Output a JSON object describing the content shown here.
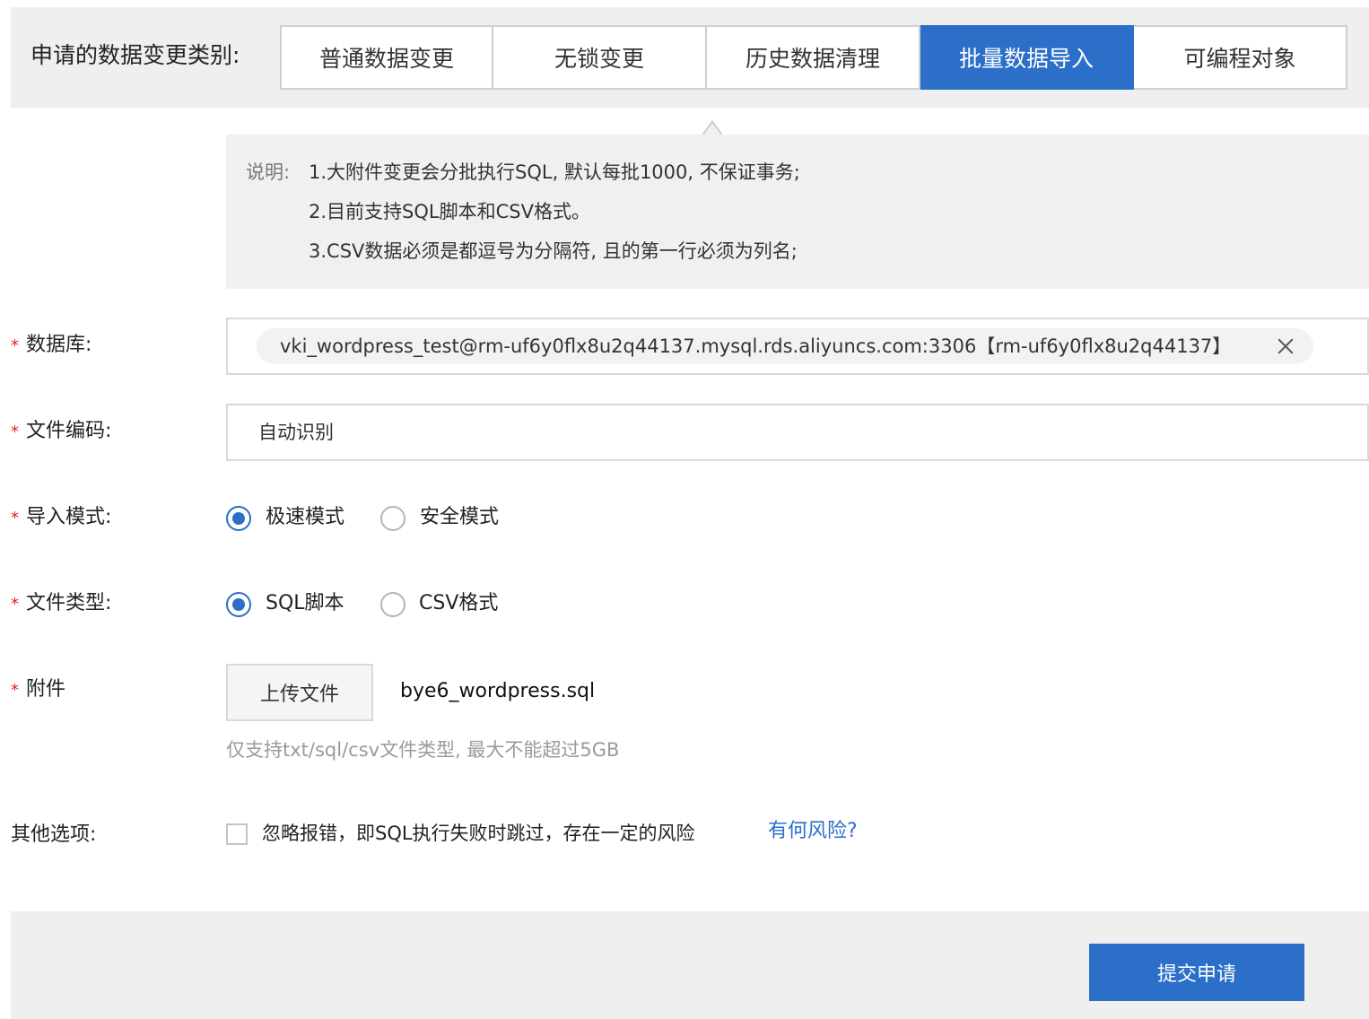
{
  "change_type": {
    "label": "申请的数据变更类别:",
    "tabs": [
      {
        "label": "普通数据变更",
        "active": false
      },
      {
        "label": "无锁变更",
        "active": false
      },
      {
        "label": "历史数据清理",
        "active": false
      },
      {
        "label": "批量数据导入",
        "active": true
      },
      {
        "label": "可编程对象",
        "active": false
      }
    ]
  },
  "note": {
    "title": "说明:",
    "lines": [
      "1.大附件变更会分批执行SQL, 默认每批1000, 不保证事务;",
      "2.目前支持SQL脚本和CSV格式。",
      "3.CSV数据必须是都逗号为分隔符, 且的第一行必须为列名;"
    ]
  },
  "required_mark": "*",
  "database": {
    "label": "数据库:",
    "selected": "vki_wordpress_test@rm-uf6y0flx8u2q44137.mysql.rds.aliyuncs.com:3306【rm-uf6y0flx8u2q44137】"
  },
  "encoding": {
    "label": "文件编码:",
    "value": "自动识别"
  },
  "import_mode": {
    "label": "导入模式:",
    "options": [
      "极速模式",
      "安全模式"
    ],
    "selected": "极速模式"
  },
  "file_type": {
    "label": "文件类型:",
    "options": [
      "SQL脚本",
      "CSV格式"
    ],
    "selected": "SQL脚本"
  },
  "attachment": {
    "label": "附件",
    "upload_label": "上传文件",
    "file_name": "bye6_wordpress.sql",
    "hint": "仅支持txt/sql/csv文件类型, 最大不能超过5GB"
  },
  "other_options": {
    "label": "其他选项:",
    "ignore_error_label": "忽略报错，即SQL执行失败时跳过，存在一定的风险",
    "ignore_error_checked": false,
    "risk_link": "有何风险?"
  },
  "footer": {
    "submit_label": "提交申请"
  },
  "colors": {
    "accent": "#2b6fc8",
    "required": "#e02020",
    "panel": "#efefef"
  }
}
